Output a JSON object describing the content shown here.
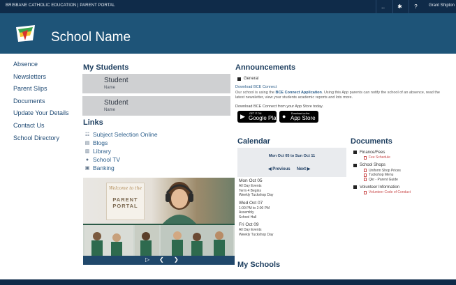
{
  "topbar": {
    "portal_title": "BRISBANE CATHOLIC EDUCATION | PARENT PORTAL",
    "icons": [
      "text-size-icon",
      "gear-icon",
      "help-icon"
    ],
    "icon_glyphs": [
      "‥",
      "✱",
      "?"
    ],
    "user_name": "Grant Shipton"
  },
  "header": {
    "school_name": "School Name",
    "logo_icon": "school-crest-logo"
  },
  "sidebar": {
    "items": [
      {
        "label": "Absence"
      },
      {
        "label": "Newsletters"
      },
      {
        "label": "Parent Slips"
      },
      {
        "label": "Documents"
      },
      {
        "label": "Update Your Details"
      },
      {
        "label": "Contact Us"
      },
      {
        "label": "School Directory"
      }
    ]
  },
  "students": {
    "heading": "My Students",
    "cards": [
      {
        "name": "Student",
        "label": "Name"
      },
      {
        "name": "Student",
        "label": "Name"
      }
    ]
  },
  "links": {
    "heading": "Links",
    "items": [
      {
        "label": "Subject Selection Online",
        "icon": "columns-icon",
        "glyph": "☷"
      },
      {
        "label": "Blogs",
        "icon": "blog-icon",
        "glyph": "▤"
      },
      {
        "label": "Library",
        "icon": "library-icon",
        "glyph": "▥"
      },
      {
        "label": "School TV",
        "icon": "tv-icon",
        "glyph": "●"
      },
      {
        "label": "Banking",
        "icon": "banking-icon",
        "glyph": "▣"
      }
    ]
  },
  "banner": {
    "card_line1": "Welcome to the",
    "card_line2": "PARENT",
    "card_line3": "PORTAL",
    "controls": [
      "▷",
      "❮",
      "❯"
    ]
  },
  "announcements": {
    "heading": "Announcements",
    "category": "General",
    "title": "Download BCE Connect",
    "body_prefix": "Our school is using the ",
    "body_app": "BCE Connect Application",
    "body_suffix": ". Using this App parents can notify the school of an absence, read the latest newsletter, view your students academic reports and lots more.",
    "download_line": "Download BCE Connect from your App Store today.",
    "google_small": "GET IT ON",
    "google_big": "Google Play",
    "apple_small": "Download on the",
    "apple_big": "App Store"
  },
  "calendar": {
    "heading": "Calendar",
    "range": "Mon Oct 05 to Sun Oct 11",
    "prev_label": "◀ Previous",
    "next_label": "Next ▶",
    "events": [
      {
        "day": "Mon Oct 05",
        "lines": [
          "All Day Events",
          "Term 4 Begins",
          "Weekly Tuckshop Day"
        ]
      },
      {
        "day": "Wed Oct 07",
        "lines": [
          "1:00 PM to 2:00 PM",
          "Assembly",
          "School Hall"
        ]
      },
      {
        "day": "Fri Oct 09",
        "lines": [
          "All Day Events",
          "Weekly Tuckshop Day"
        ]
      }
    ]
  },
  "my_schools": {
    "heading": "My Schools"
  },
  "documents": {
    "heading": "Documents",
    "groups": [
      {
        "title": "Finance/Fees",
        "files": [
          {
            "label": "Fee Schedule",
            "link": true
          }
        ]
      },
      {
        "title": "School Shops",
        "files": [
          {
            "label": "Uniform Shop Prices",
            "link": false
          },
          {
            "label": "Tuckshop Menu",
            "link": false
          },
          {
            "label": "Qkr - Parent Guide",
            "link": false
          }
        ]
      },
      {
        "title": "Volunteer Information",
        "files": [
          {
            "label": "Volunteer Code of Conduct",
            "link": true
          }
        ]
      }
    ]
  },
  "colors": {
    "topbar": "#0f2b49",
    "header": "#1e5478",
    "heading_text": "#1c3d5e",
    "link_text": "#2a5d8a",
    "student_card": "#cfd0d2",
    "doc_link": "#c94a4a"
  }
}
